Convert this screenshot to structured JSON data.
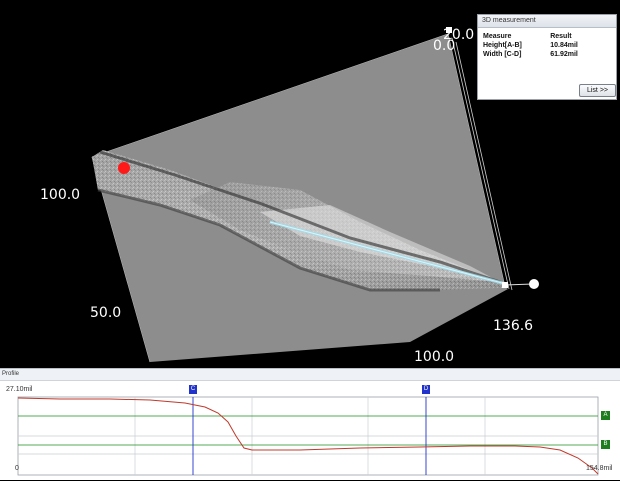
{
  "viewport": {
    "axis_labels": {
      "z_max": "20.0",
      "z_min": "0.0",
      "y_100": "100.0",
      "y_50": "50.0",
      "x_100": "100.0",
      "x_max": "136.6"
    },
    "colors": {
      "background": "#000000",
      "marker": "#ff1a1a",
      "highlight": "#9fdcea"
    }
  },
  "measurement_panel": {
    "title": "3D measurement",
    "columns": [
      "Measure",
      "Result"
    ],
    "rows": [
      {
        "measure": "Height[A-B]",
        "result": "10.84mil"
      },
      {
        "measure": "Width [C-D]",
        "result": "61.92mil"
      }
    ],
    "list_button": "List >>"
  },
  "profile": {
    "title": "Profile",
    "y_max_label": "27.10mil",
    "x_min_label": "0",
    "x_max_label": "154.8mil",
    "cursor_c": "C",
    "cursor_d": "D",
    "line_a": "A",
    "line_b": "B",
    "colors": {
      "profile_line": "#c0392b",
      "cursor": "#2233cc",
      "ref_line": "#1e8c1e",
      "grid": "#c9cdd3"
    }
  }
}
